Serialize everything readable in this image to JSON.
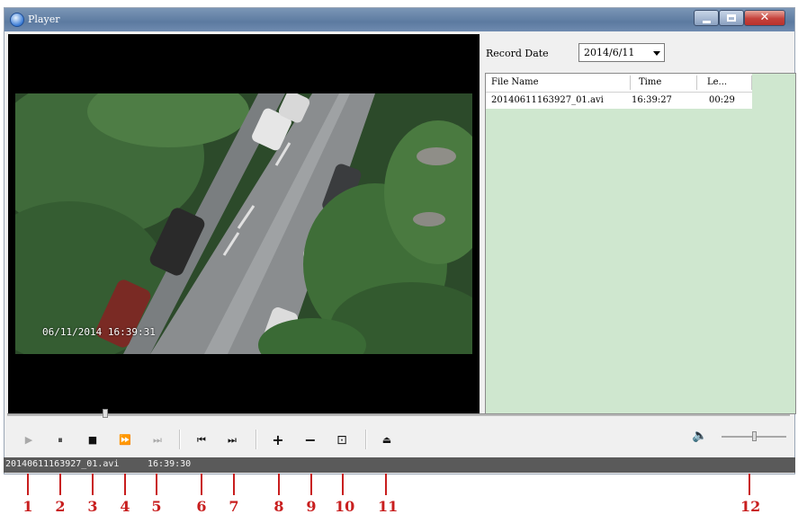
{
  "window": {
    "title": "Player",
    "close_glyph": "✕"
  },
  "video": {
    "osd_timestamp": "06/11/2014 16:39:31"
  },
  "side_panel": {
    "record_date_label": "Record Date",
    "record_date_value": "2014/6/11",
    "columns": [
      "File Name",
      "Time",
      "Le..."
    ],
    "rows": [
      {
        "file_name": "20140611163927_01.avi",
        "time": "16:39:27",
        "length": "00:29"
      }
    ]
  },
  "controls": {
    "play": "▶",
    "pause": "⏸",
    "stop": "■",
    "fast_forward": "⏩",
    "next_frame": "⏭",
    "prev_file": "⏮",
    "next_file": "⏭",
    "zoom_in": "+",
    "zoom_out": "−",
    "fullscreen": "⊡",
    "eject": "⏏",
    "volume": "🔈"
  },
  "status_bar": {
    "file_name": "20140611163927_01.avi",
    "time": "16:39:30"
  },
  "callouts": [
    "1",
    "2",
    "3",
    "4",
    "5",
    "6",
    "7",
    "8",
    "9",
    "10",
    "11",
    "12"
  ],
  "colors": {
    "callout": "#c81e1e",
    "list_background": "#cfe7cf",
    "titlebar": "#5c7aa0"
  }
}
